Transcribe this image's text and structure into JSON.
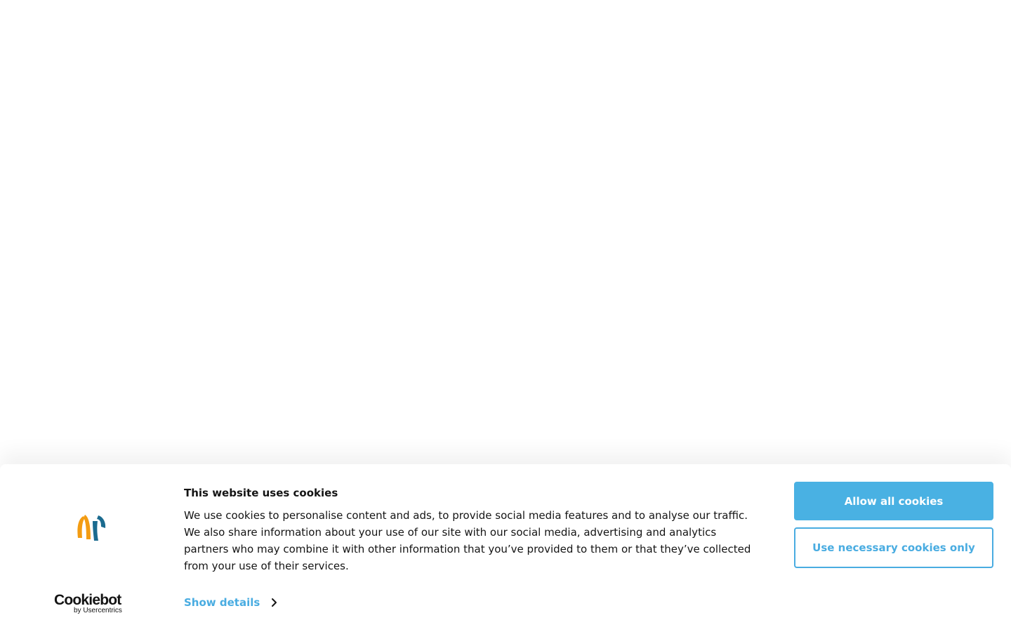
{
  "banner": {
    "title": "This website uses cookies",
    "body": "We use cookies to personalise content and ads, to provide social media features and to analyse our traffic. We also share information about your use of our site with our social media, advertising and analytics partners who may combine it with other information that you’ve provided to them or that they’ve collected from your use of their services.",
    "show_details_label": "Show details",
    "allow_all_label": "Allow all cookies",
    "necessary_only_label": "Use necessary cookies only"
  },
  "branding": {
    "cookiebot_wordmark": "Cookiebot",
    "cookiebot_byline": "by Usercentrics"
  },
  "icons": {
    "brand_logo": "brand-logo-icon",
    "show_details_chevron": "chevron-right-icon"
  },
  "colors": {
    "accent": "#49ace1",
    "primary_button": "#49b1e3",
    "text": "#141414",
    "logo_orange": "#f39c12",
    "logo_blue": "#1b6b8f"
  }
}
